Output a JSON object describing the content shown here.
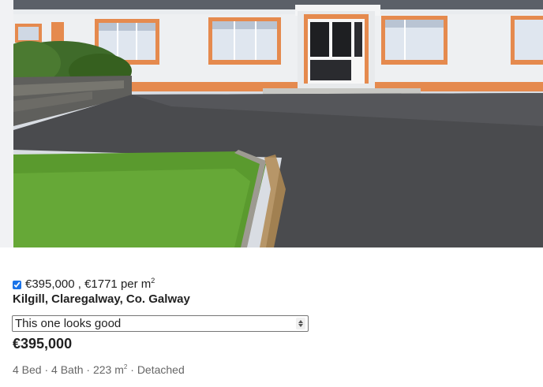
{
  "listing": {
    "photo_alt": "Bungalow with orange-trimmed windows, tarmac driveway and lawn",
    "price_summary": "€395,000 , €1771 per m",
    "price_summary_sup": "2",
    "checkbox_checked": true,
    "address": "Kilgill, Claregalway, Co. Galway",
    "note_selected": "This one looks good",
    "price": "€395,000",
    "specs": {
      "beds": "4 Bed",
      "baths": "4 Bath",
      "area": "223 m",
      "area_sup": "2",
      "type": "Detached",
      "separator": "·"
    }
  },
  "colors": {
    "checkbox": "#1a73e8",
    "text": "#222222",
    "muted": "#666666"
  }
}
